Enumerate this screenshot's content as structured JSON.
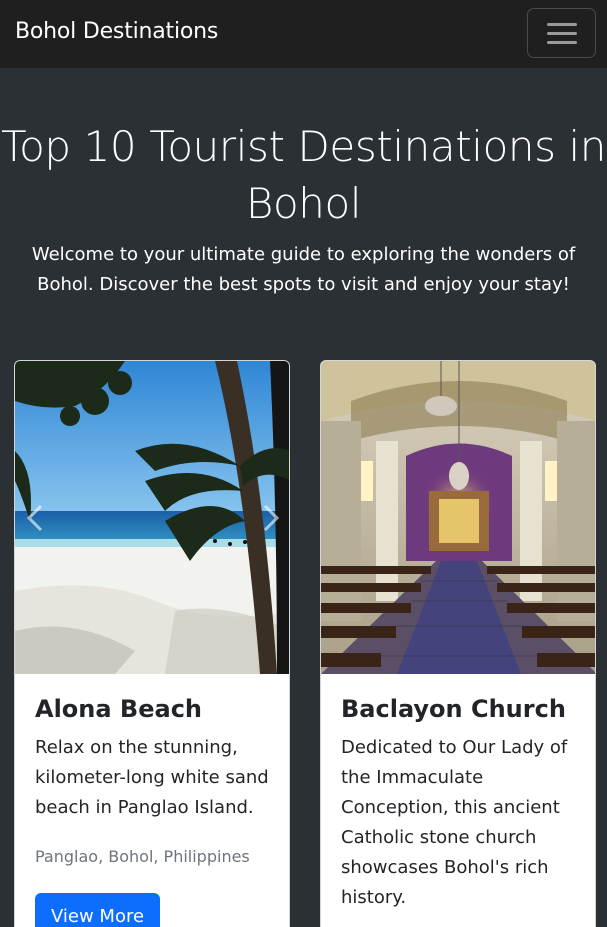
{
  "navbar": {
    "brand": "Bohol Destinations",
    "toggler_icon": "hamburger-menu-icon"
  },
  "hero": {
    "title": "Top 10 Tourist Destinations in Bohol",
    "subtitle": "Welcome to your ultimate guide to exploring the wonders of Bohol. Discover the best spots to visit and enjoy your stay!"
  },
  "cards": [
    {
      "title": "Alona Beach",
      "description": "Relax on the stunning, kilometer-long white sand beach in Panglao Island.",
      "location": "Panglao, Bohol, Philippines",
      "button_label": "View More",
      "image_icon": "beach-photo"
    },
    {
      "title": "Baclayon Church",
      "description": "Dedicated to Our Lady of the Immaculate Conception, this ancient Catholic stone church showcases Bohol's rich history.",
      "image_icon": "church-interior-photo"
    }
  ],
  "colors": {
    "navbar_bg": "#1f1f1f",
    "page_bg": "#2b3035",
    "primary_button": "#0d6efd",
    "muted_text": "#6c757d"
  }
}
